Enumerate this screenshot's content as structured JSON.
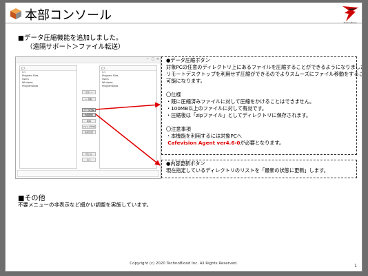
{
  "title": "本部コンソール",
  "logo": {
    "text": "TechnoBlood"
  },
  "heading": {
    "main": "■データ圧縮機能を追加しました。",
    "sub": "（遠隔サポート＞ファイル転送）"
  },
  "box1": {
    "lines": [
      "●データ圧縮ボタン",
      "対象PCの任意のディレクトリ上にあるファイルを圧縮することができるようになりました。",
      "リモートデスクトップを利用せず圧縮ができるのでよりスムーズにファイル移動をすることが",
      "可能になります。",
      "",
      "〇仕様",
      "・既に圧縮済みファイルに対して圧縮をかけることはできません。",
      "・100MB以上のファイルに対して有効です。",
      "・圧縮後は「zipファイル」としてディレクトリに保存されます。",
      "",
      "〇注意事項",
      "・本機能を利用するには対象PCへ"
    ],
    "agent_version": "Cafevision Agent ver4.6-0",
    "agent_suffix": "が必要となります。"
  },
  "box2": {
    "title": "●内容更新ボタン",
    "desc": "現在指定しているディレクトリのリストを「最新の状態に更新」します。"
  },
  "screenshot": {
    "left_path": "C:\\",
    "right_path": "C:\\",
    "left_files": [
      "C:\\",
      "Program Files",
      "Users",
      "Windows",
      "ProgramData"
    ],
    "right_files": [
      "C:\\",
      "Program Files",
      "Users",
      "Windows",
      "ProgramData"
    ],
    "buttons": [
      "送る →",
      "← 受取",
      "データ圧縮",
      "内容更新",
      "削除",
      "フォルダ作成",
      "名前変更",
      "閉じる",
      "戻る"
    ]
  },
  "section2": {
    "title": "■その他",
    "body": "不要メニューの非表示など細かい調整を実施しています。"
  },
  "footer": "Copyright (c) 2020 TechnoBlood Inc. All Rights Reserved.",
  "page_number": "1"
}
